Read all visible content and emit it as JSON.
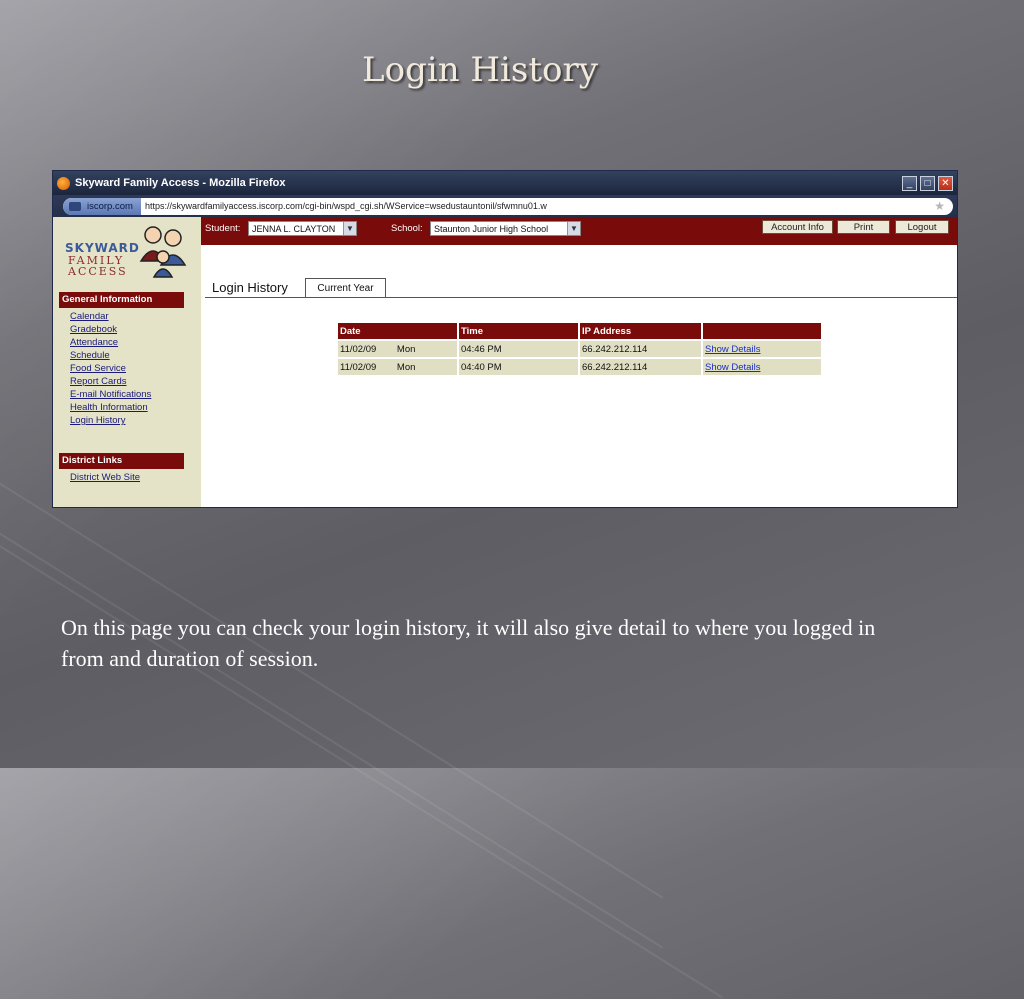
{
  "slide": {
    "title": "Login History",
    "caption": "On this page you can check your login history, it will also give detail to where you logged in from and duration of session."
  },
  "browser": {
    "window_title": "Skyward Family Access - Mozilla Firefox",
    "site_identity": "iscorp.com",
    "url": "https://skywardfamilyaccess.iscorp.com/cgi-bin/wspd_cgi.sh/WService=wsedustauntonil/sfwmnu01.w"
  },
  "logo": {
    "line1": "SKYWARD",
    "line2": "FAMILY",
    "line3": "ACCESS"
  },
  "topbar": {
    "student_label": "Student:",
    "student_value": "JENNA L. CLAYTON",
    "school_label": "School:",
    "school_value": "Staunton Junior High School",
    "buttons": [
      "Account Info",
      "Print",
      "Logout"
    ]
  },
  "sidebar": {
    "general_header": "General Information",
    "general_items": [
      "Calendar",
      "Gradebook",
      "Attendance",
      "Schedule",
      "Food Service",
      "Report Cards",
      "E-mail Notifications",
      "Health Information",
      "Login History"
    ],
    "district_header": "District Links",
    "district_items": [
      "District Web Site"
    ]
  },
  "main": {
    "title": "Login History",
    "tab_label": "Current Year",
    "columns": [
      "Date",
      "Time",
      "IP Address",
      ""
    ],
    "rows": [
      {
        "date": "11/02/09",
        "day": "Mon",
        "time": "04:46 PM",
        "ip": "66.242.212.114",
        "action": "Show Details"
      },
      {
        "date": "11/02/09",
        "day": "Mon",
        "time": "04:40 PM",
        "ip": "66.242.212.114",
        "action": "Show Details"
      }
    ]
  },
  "colors": {
    "maroon": "#7a0b0b",
    "sidebar_bg": "#e4e3c8",
    "row_bg": "#e0dfc3",
    "link": "#1a2ec7"
  }
}
